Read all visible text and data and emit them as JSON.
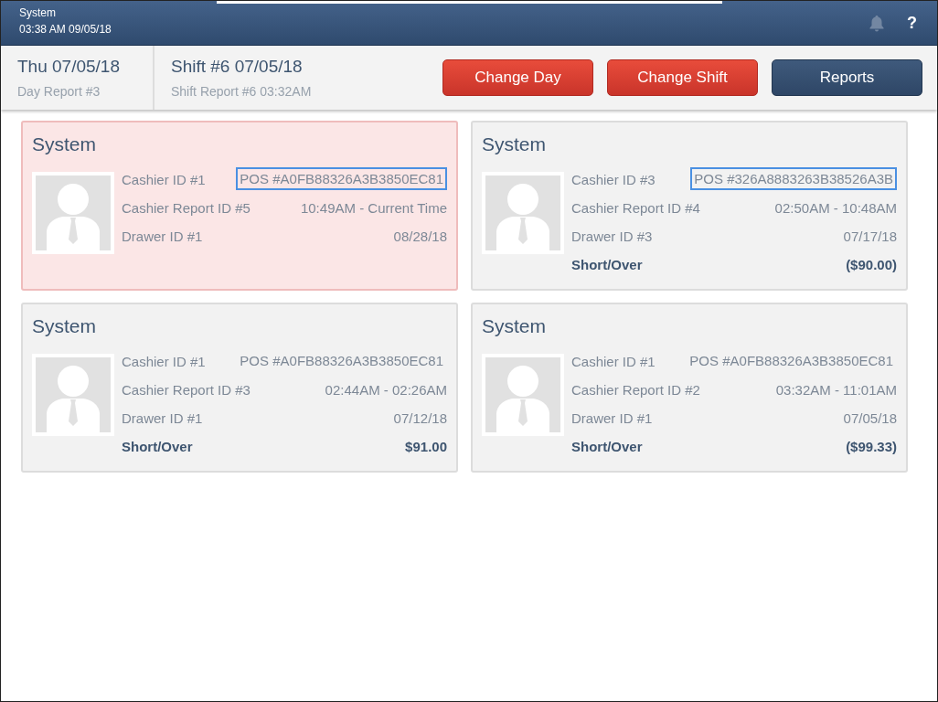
{
  "top_bar": {
    "title": "System",
    "datetime": "03:38 AM 09/05/18",
    "notifications_disabled": true,
    "help": "?"
  },
  "header": {
    "day": {
      "title": "Thu 07/05/18",
      "subtitle": "Day Report #3"
    },
    "shift": {
      "title": "Shift #6 07/05/18",
      "subtitle": "Shift Report #6 03:32AM"
    },
    "buttons": [
      {
        "label": "Change Day",
        "kind": "danger"
      },
      {
        "label": "Change Shift",
        "kind": "danger"
      },
      {
        "label": "Reports",
        "kind": "primary"
      }
    ]
  },
  "cards": [
    {
      "name": "System",
      "selected": true,
      "cashier": "Cashier ID #1",
      "pos": "POS #A0FB88326A3B3850EC81",
      "pos_highlighted": true,
      "report": "Cashier Report ID #5",
      "time": "10:49AM - Current Time",
      "drawer": "Drawer ID #1",
      "date": "08/28/18"
    },
    {
      "name": "System",
      "selected": false,
      "cashier": "Cashier ID #3",
      "pos": "POS #326A8883263B38526A3B",
      "pos_highlighted": true,
      "report": "Cashier Report ID #4",
      "time": "02:50AM - 10:48AM",
      "drawer": "Drawer ID #3",
      "date": "07/17/18",
      "short_over_label": "Short/Over",
      "short_over": "($90.00)"
    },
    {
      "name": "System",
      "selected": false,
      "cashier": "Cashier ID #1",
      "pos": "POS #A0FB88326A3B3850EC81",
      "pos_highlighted": false,
      "report": "Cashier Report ID #3",
      "time": "02:44AM - 02:26AM",
      "drawer": "Drawer ID #1",
      "date": "07/12/18",
      "short_over_label": "Short/Over",
      "short_over": "$91.00"
    },
    {
      "name": "System",
      "selected": false,
      "cashier": "Cashier ID #1",
      "pos": "POS #A0FB88326A3B3850EC81",
      "pos_highlighted": false,
      "report": "Cashier Report ID #2",
      "time": "03:32AM - 11:01AM",
      "drawer": "Drawer ID #1",
      "date": "07/05/18",
      "short_over_label": "Short/Over",
      "short_over": "($99.33)"
    }
  ]
}
